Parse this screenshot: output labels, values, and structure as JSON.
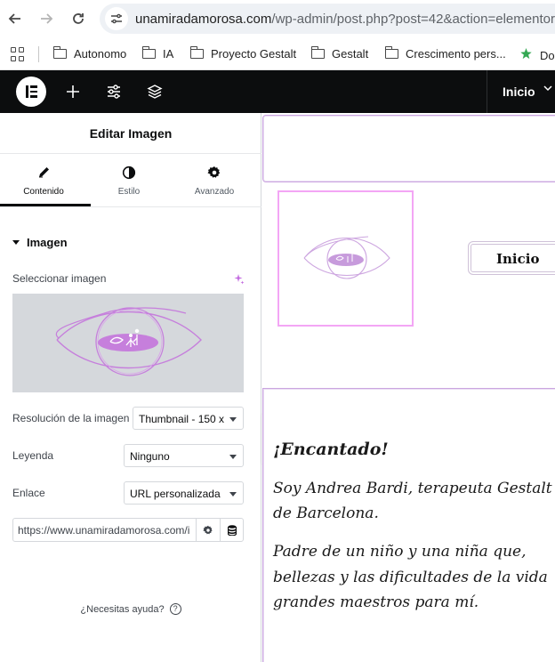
{
  "browser": {
    "url_domain": "unamiradamorosa.com",
    "url_rest": "/wp-admin/post.php?post=42&action=elementor",
    "bookmarks": [
      "Autonomo",
      "IA",
      "Proyecto Gestalt",
      "Gestalt",
      "Crescimento pers...",
      "Doc"
    ]
  },
  "editor": {
    "page_selector": "Inicio"
  },
  "panel": {
    "title": "Editar Imagen",
    "tabs": [
      {
        "label": "Contenido",
        "icon": "pencil-icon",
        "active": true
      },
      {
        "label": "Estilo",
        "icon": "half-circle-icon",
        "active": false
      },
      {
        "label": "Avanzado",
        "icon": "gear-icon",
        "active": false
      }
    ],
    "section_title": "Imagen",
    "select_image_label": "Seleccionar imagen",
    "resolution_label": "Resolución de la imagen",
    "resolution_value": "Thumbnail - 150 x",
    "caption_label": "Leyenda",
    "caption_value": "Ninguno",
    "link_label": "Enlace",
    "link_value": "URL personalizada",
    "url_value": "https://www.unamiradamorosa.com/i",
    "help_text": "¿Necesitas ayuda?"
  },
  "canvas": {
    "button_label": "Inicio",
    "heading": "¡Encantado!",
    "para1_line1": "Soy Andrea Bardi, terapeuta Gestalt y",
    "para1_line2": "de Barcelona.",
    "para2_line1": "Padre de un niño y una niña que,",
    "para2_line2": "bellezas y las dificultades de la vida",
    "para2_line3": "grandes maestros para mí."
  },
  "colors": {
    "accent": "#c36be0",
    "selection_border": "#f3a6f5",
    "editor_bar": "#0c0d0e"
  }
}
